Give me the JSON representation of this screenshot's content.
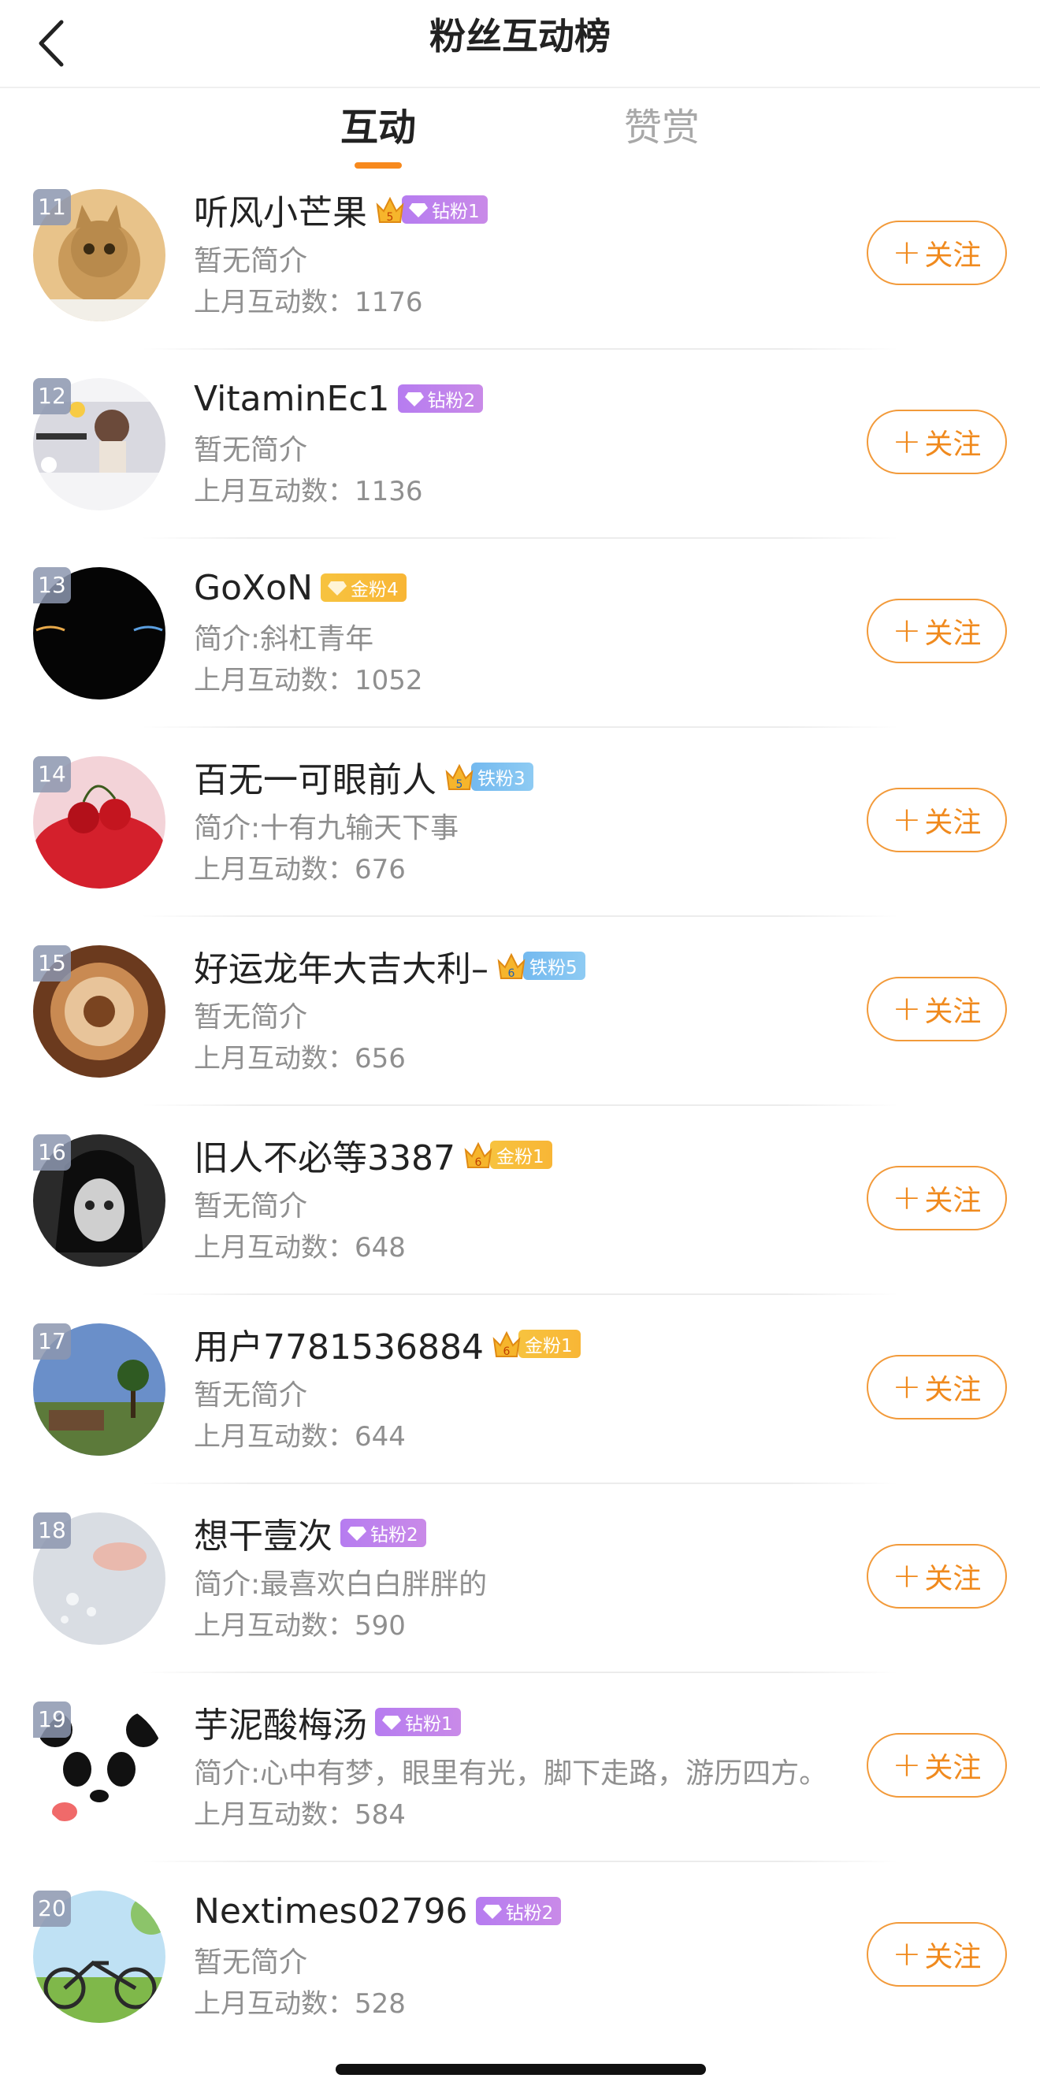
{
  "nav": {
    "title": "粉丝互动榜",
    "back_icon": "chevron-left-icon"
  },
  "tabs": [
    {
      "label": "互动",
      "active": true
    },
    {
      "label": "赞赏",
      "active": false
    }
  ],
  "colors": {
    "accent": "#f7891d",
    "diamond": "#b67cf0",
    "gold": "#f7c33f",
    "iron": "#73b9ef"
  },
  "follow_label": "关注",
  "users": [
    {
      "rank": "11",
      "name": "听风小芒果",
      "badge_type": "diamond",
      "badge_label": "钻粉1",
      "crown": "5",
      "bio": "暂无简介",
      "stat": "上月互动数：1176"
    },
    {
      "rank": "12",
      "name": "VitaminEc1",
      "badge_type": "diamond",
      "badge_label": "钻粉2",
      "crown": "",
      "bio": "暂无简介",
      "stat": "上月互动数：1136"
    },
    {
      "rank": "13",
      "name": "GoXoN",
      "badge_type": "gold",
      "badge_label": "金粉4",
      "crown": "",
      "bio": "简介:斜杠青年",
      "stat": "上月互动数：1052"
    },
    {
      "rank": "14",
      "name": "百无一可眼前人",
      "badge_type": "iron",
      "badge_label": "铁粉3",
      "crown": "5",
      "bio": "简介:十有九输天下事",
      "stat": "上月互动数：676"
    },
    {
      "rank": "15",
      "name": "好运龙年大吉大利–",
      "badge_type": "iron",
      "badge_label": "铁粉5",
      "crown": "6",
      "bio": "暂无简介",
      "stat": "上月互动数：656"
    },
    {
      "rank": "16",
      "name": "旧人不必等3387",
      "badge_type": "gold",
      "badge_label": "金粉1",
      "crown": "6",
      "bio": "暂无简介",
      "stat": "上月互动数：648"
    },
    {
      "rank": "17",
      "name": "用户7781536884",
      "badge_type": "gold",
      "badge_label": "金粉1",
      "crown": "6",
      "bio": "暂无简介",
      "stat": "上月互动数：644"
    },
    {
      "rank": "18",
      "name": "想干壹次",
      "badge_type": "diamond",
      "badge_label": "钻粉2",
      "crown": "",
      "bio": "简介:最喜欢白白胖胖的",
      "stat": "上月互动数：590"
    },
    {
      "rank": "19",
      "name": "芋泥酸梅汤",
      "badge_type": "diamond",
      "badge_label": "钻粉1",
      "crown": "",
      "bio": "简介:心中有梦，眼里有光，脚下走路，游历四方。",
      "stat": "上月互动数：584"
    },
    {
      "rank": "20",
      "name": "Nextimes02796",
      "badge_type": "diamond",
      "badge_label": "钻粉2",
      "crown": "",
      "bio": "暂无简介",
      "stat": "上月互动数：528"
    }
  ]
}
